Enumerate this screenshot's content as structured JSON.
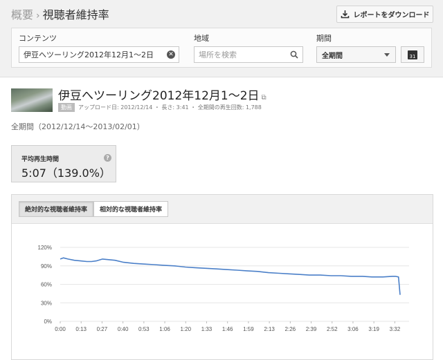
{
  "breadcrumb": {
    "parent": "概要",
    "separator": "›",
    "current": "視聴者維持率"
  },
  "download_button": {
    "label": "レポートをダウンロード"
  },
  "filters": {
    "content": {
      "label": "コンテンツ",
      "value": "伊豆へツーリング2012年12月1〜2日"
    },
    "region": {
      "label": "地域",
      "placeholder": "場所を検索"
    },
    "period": {
      "label": "期間",
      "selected": "全期間",
      "calendar_day": "31"
    }
  },
  "video": {
    "title": "伊豆へツーリング2012年12月1〜2日",
    "badge": "動画",
    "meta": "アップロード日: 2012/12/14 ・ 長さ: 3:41 ・ 全期間の再生回数: 1,788"
  },
  "period_text": "全期間（2012/12/14〜2013/02/01）",
  "stat": {
    "label": "平均再生時間",
    "value": "5:07（139.0%）",
    "help": "?"
  },
  "chart_tabs": {
    "absolute": "絶対的な視聴者維持率",
    "relative": "相対的な視聴者維持率"
  },
  "colors": {
    "line": "#4a7fc8",
    "accent_bg": "#f1f1f1"
  },
  "chart_data": {
    "type": "line",
    "title": "",
    "xlabel": "",
    "ylabel": "",
    "ylim": [
      0,
      120
    ],
    "y_ticks": [
      "0%",
      "30%",
      "60%",
      "90%",
      "120%"
    ],
    "x_ticks": [
      "0:00",
      "0:13",
      "0:27",
      "0:40",
      "0:53",
      "1:06",
      "1:20",
      "1:33",
      "1:46",
      "1:59",
      "2:13",
      "2:26",
      "2:39",
      "2:52",
      "3:06",
      "3:19",
      "3:32"
    ],
    "x_max_seconds": 221,
    "series": [
      {
        "name": "",
        "x_seconds": [
          0,
          2,
          5,
          9,
          13,
          17,
          20,
          23,
          27,
          31,
          35,
          40,
          47,
          53,
          60,
          66,
          73,
          80,
          86,
          93,
          100,
          106,
          113,
          119,
          126,
          133,
          140,
          146,
          153,
          159,
          166,
          173,
          179,
          186,
          193,
          199,
          206,
          212,
          214,
          216,
          217
        ],
        "values": [
          101,
          103,
          101,
          99,
          98,
          97,
          97,
          98,
          101,
          100,
          99,
          96,
          94,
          93,
          92,
          91,
          90,
          88,
          87,
          86,
          85,
          84,
          83,
          82,
          81,
          79,
          78,
          77,
          76,
          75,
          75,
          74,
          74,
          73,
          73,
          72,
          72,
          73,
          73,
          72,
          43
        ]
      }
    ]
  }
}
